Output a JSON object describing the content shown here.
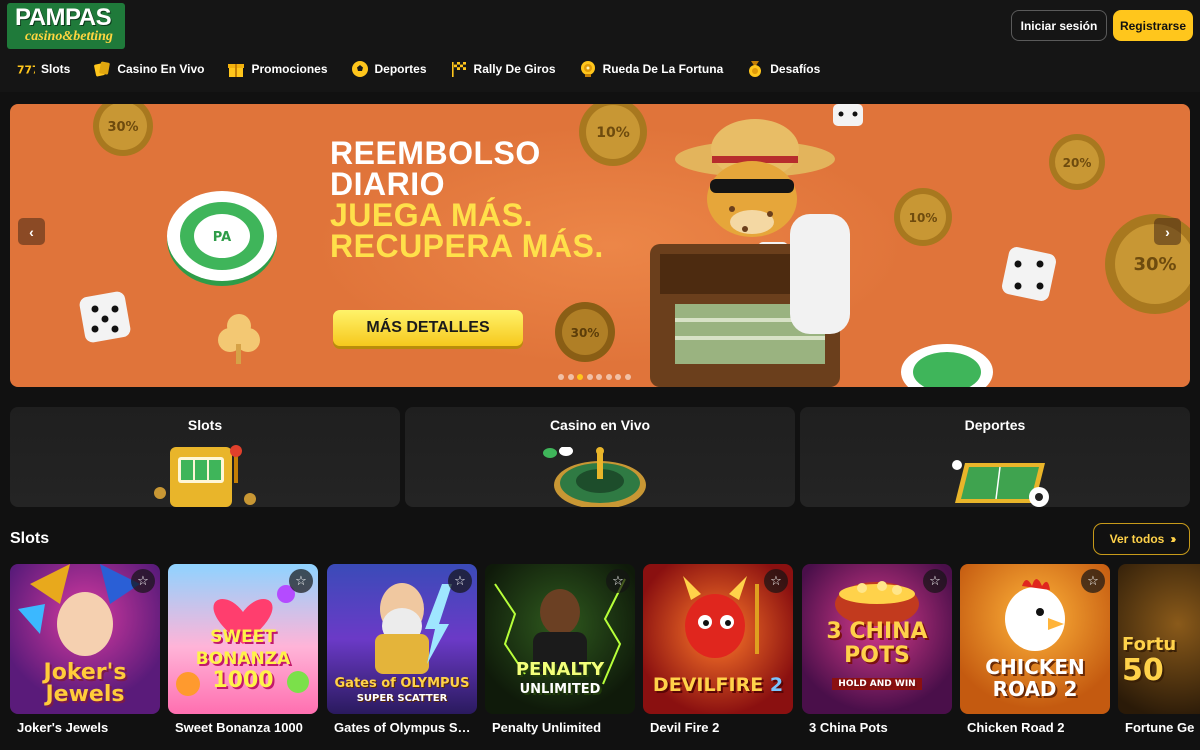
{
  "brand": {
    "name": "PAMPAS",
    "tagline": "casino&betting",
    "color": "#1f7a3a",
    "accent": "#ffc61c"
  },
  "header": {
    "login_label": "Iniciar sesión",
    "register_label": "Registrarse"
  },
  "nav": [
    {
      "label": "Slots",
      "icon": "slot-777-icon"
    },
    {
      "label": "Casino En Vivo",
      "icon": "cards-icon"
    },
    {
      "label": "Promociones",
      "icon": "gift-icon"
    },
    {
      "label": "Deportes",
      "icon": "soccer-ball-icon"
    },
    {
      "label": "Rally De Giros",
      "icon": "checkered-flag-icon"
    },
    {
      "label": "Rueda De La Fortuna",
      "icon": "fortune-wheel-icon"
    },
    {
      "label": "Desafíos",
      "icon": "medal-icon"
    }
  ],
  "banner": {
    "line1": "REEMBOLSO",
    "line2": "DIARIO",
    "line3": "JUEGA MÁS.",
    "line4": "RECUPERA MÁS.",
    "cta": "MÁS DETALLES",
    "slide_count": 8,
    "active_slide": 3,
    "coin_labels": [
      "30%",
      "10%",
      "20%",
      "10%",
      "30%",
      "30%"
    ],
    "chip_label": "PA"
  },
  "categories": [
    {
      "title": "Slots"
    },
    {
      "title": "Casino en Vivo"
    },
    {
      "title": "Deportes"
    }
  ],
  "slots": {
    "title": "Slots",
    "see_all": "Ver todos",
    "games": [
      {
        "name": "Joker's Jewels",
        "art_line1": "Joker's",
        "art_line2": "Jewels"
      },
      {
        "name": "Sweet Bonanza 1000",
        "art_line1": "SWEET BONANZA",
        "art_line2": "1000"
      },
      {
        "name": "Gates of Olympus Su...",
        "art_line1": "Gates of OLYMPUS",
        "art_line2": "SUPER SCATTER"
      },
      {
        "name": "Penalty Unlimited",
        "art_line1": "PENALTY",
        "art_line2": "UNLIMITED"
      },
      {
        "name": "Devil Fire 2",
        "art_line1": "DEVILFIRE",
        "art_line2": "2"
      },
      {
        "name": "3 China Pots",
        "art_line1": "3 CHINA POTS",
        "art_line2": "HOLD AND WIN"
      },
      {
        "name": "Chicken Road 2",
        "art_line1": "CHICKEN",
        "art_line2": "ROAD 2"
      },
      {
        "name": "Fortune Ge",
        "art_line1": "Fortu",
        "art_line2": "50"
      }
    ]
  }
}
